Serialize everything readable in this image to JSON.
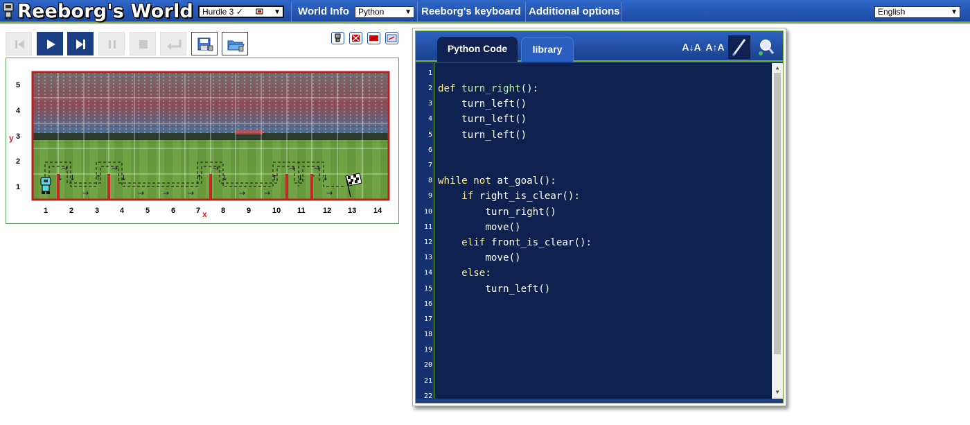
{
  "header": {
    "title": "Reeborg's World",
    "world_select": "Hurdle 3 ✓",
    "menu_world_info": "World Info",
    "language_select": "Python",
    "menu_keyboard": "Reeborg's keyboard",
    "menu_options": "Additional options",
    "ui_language_select": "English",
    "colors": {
      "bar": "#1c4aa3",
      "accent": "#7bb03b"
    }
  },
  "controls": {
    "buttons": [
      {
        "name": "reverse-step-icon",
        "enabled": false
      },
      {
        "name": "run-icon",
        "enabled": true
      },
      {
        "name": "step-icon",
        "enabled": true
      },
      {
        "name": "pause-icon",
        "enabled": false
      },
      {
        "name": "stop-icon",
        "enabled": false
      },
      {
        "name": "reload-icon",
        "enabled": false
      },
      {
        "name": "save-world-icon",
        "enabled": true
      },
      {
        "name": "open-world-icon",
        "enabled": true
      }
    ],
    "tools": [
      "robot-tool-icon",
      "remove-walls-tool-icon",
      "flag-tool-icon",
      "edit-world-tool-icon"
    ]
  },
  "world": {
    "y_label": "y",
    "x_label": "x",
    "x_ticks": [
      "1",
      "2",
      "3",
      "4",
      "5",
      "6",
      "7",
      "8",
      "9",
      "10",
      "11",
      "12",
      "13",
      "14"
    ],
    "y_ticks": [
      "1",
      "2",
      "3",
      "4",
      "5"
    ],
    "robot": {
      "x": 1,
      "y": 1
    },
    "goal": {
      "x": 13,
      "y": 1
    },
    "walls_east_of_column": [
      1,
      3,
      7,
      10,
      11
    ],
    "background": "stadium-photo"
  },
  "editor": {
    "tabs": [
      "Python Code",
      "library"
    ],
    "active_tab": "Python Code",
    "tools": [
      "decrease-font-icon",
      "increase-font-icon",
      "highlight-icon",
      "search-icon"
    ],
    "code_lines": [
      "",
      "def turn_right():",
      "    turn_left()",
      "    turn_left()",
      "    turn_left()",
      "",
      "",
      "while not at_goal():",
      "    if right_is_clear():",
      "        turn_right()",
      "        move()",
      "    elif front_is_clear():",
      "        move()",
      "    else:",
      "        turn_left()",
      "",
      "",
      "",
      "",
      "",
      "",
      ""
    ],
    "line_numbers": [
      "1",
      "2",
      "3",
      "4",
      "5",
      "6",
      "7",
      "8",
      "9",
      "10",
      "11",
      "12",
      "13",
      "14",
      "15",
      "16",
      "17",
      "18",
      "19",
      "20",
      "21",
      "22"
    ],
    "colors": {
      "background": "#0f214f",
      "keyword": "#ffee88",
      "function": "#b7f0a4"
    }
  }
}
